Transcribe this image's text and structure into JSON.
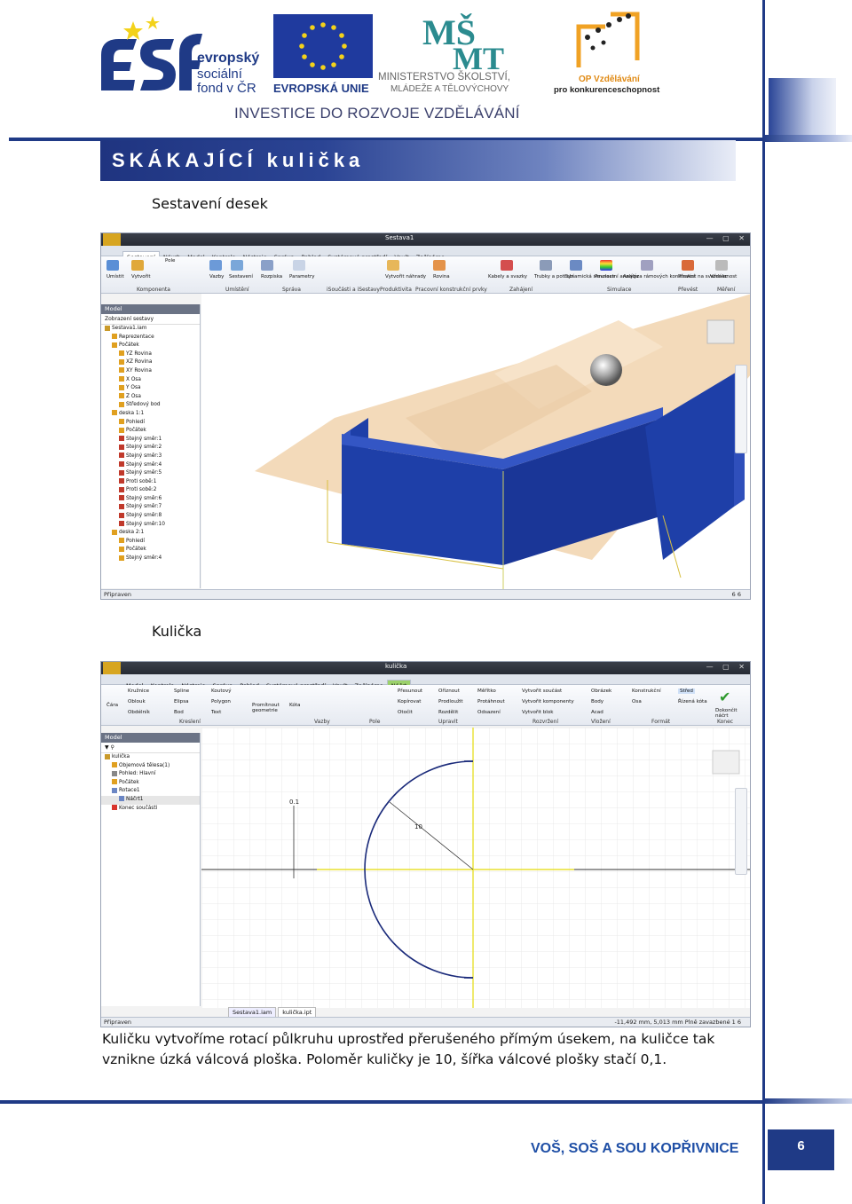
{
  "header": {
    "esf_text": [
      "evropský",
      "sociální",
      "fond v ČR"
    ],
    "eu_text": "EVROPSKÁ UNIE",
    "msmt_text": [
      "MINISTERSTVO ŠKOLSTVÍ,",
      "MLÁDEŽE A TĚLOVÝCHOVY"
    ],
    "opvk_text": [
      "OP Vzdělávání",
      "pro konkurenceschopnost"
    ],
    "investice": "INVESTICE DO ROZVOJE VZDĚLÁVÁNÍ",
    "title": "SKÁKAJÍCÍ kulička"
  },
  "section1": {
    "caption": "Sestavení desek",
    "window_title": "Sestava1",
    "tabs": [
      "Sestavení",
      "Návrh",
      "Model",
      "Kontrola",
      "Nástroje",
      "Správa",
      "Pohled",
      "Systémové prostředí",
      "Vault",
      "Začínáme"
    ],
    "ribbon_buttons": [
      "Umístit",
      "Vytvořit",
      "Pole",
      "Vazby",
      "Sestavení",
      "Rozpiska",
      "Parametry",
      "Vytvořit náhrady",
      "Rovina",
      "Kabely a svazky",
      "Trubky a potrubí",
      "Dynamická simulace",
      "Pevnostní analýza",
      "Analýza rámových konstrukcí",
      "Převést na svařenec",
      "Vzdálenost"
    ],
    "ribbon_groups": [
      "Komponenta",
      "Umístění",
      "Správa",
      "iSoučásti a iSestavy",
      "Produktivita",
      "Pracovní konstrukční prvky",
      "Zahájení",
      "Simulace",
      "Převést",
      "Měření"
    ],
    "browser_header": "Model",
    "browser_filter": "Zobrazení sestavy",
    "tree": [
      "Sestava1.iam",
      "Reprezentace",
      "Počátek",
      "YZ Rovina",
      "XZ Rovina",
      "XY Rovina",
      "X Osa",
      "Y Osa",
      "Z Osa",
      "Středový bod",
      "deska 1:1",
      "Pohledí",
      "Počátek",
      "Stejný směr:1",
      "Stejný směr:2",
      "Stejný směr:3",
      "Stejný směr:4",
      "Stejný směr:5",
      "Proti sobě:1",
      "Proti sobě:2",
      "Stejný směr:6",
      "Stejný směr:7",
      "Stejný směr:8",
      "Stejný směr:10",
      "deska 2:1",
      "Pohledí",
      "Počátek",
      "Stejný směr:4"
    ],
    "status_left": "Připraven",
    "status_right": "6    6"
  },
  "section2": {
    "caption": "Kulička",
    "window_title": "kulička",
    "tabs": [
      "Model",
      "Kontrola",
      "Nástroje",
      "Správa",
      "Pohled",
      "Systémové prostředí",
      "Vault",
      "Začínáme",
      "Náčrt"
    ],
    "ribbon_buttons": [
      "Čára",
      "Kružnice",
      "Oblouk",
      "Obdélník",
      "Spline",
      "Elipsa",
      "Bod",
      "Koutový",
      "Polygon",
      "Text",
      "Promítnout geometrie",
      "Kóta",
      "Přesunout",
      "Kopírovat",
      "Otočit",
      "Oříznout",
      "Prodloužit",
      "Rozdělit",
      "Měřítko",
      "Protáhnout",
      "Odsazení",
      "Vytvořit součást",
      "Vytvořit komponenty",
      "Vytvořit blok",
      "Obrázek",
      "Body",
      "Acad",
      "Konstrukční",
      "Osa",
      "Střed",
      "Řízená kóta",
      "Dokončit náčrt"
    ],
    "ribbon_groups": [
      "Kreslení",
      "Vazby",
      "Pole",
      "Upravit",
      "Rozvržení",
      "Vložení",
      "Formát",
      "Konec"
    ],
    "browser_header": "Model",
    "tree": [
      "kulička",
      "Objemová tělesa(1)",
      "Pohled: Hlavní",
      "Počátek",
      "Rotace1",
      "Náčrt1",
      "Konec součásti"
    ],
    "dim_small": "0.1",
    "dim_radius": "10",
    "file_tabs": [
      "Sestava1.iam",
      "kulička.ipt"
    ],
    "status_left": "Připraven",
    "status_right": "-11,492 mm, 5,013 mm    Plně zavazbené    1    6"
  },
  "body_text": "Kuličku vytvoříme rotací půlkruhu uprostřed přerušeného přímým úsekem, na kuličce tak vznikne úzká válcová ploška. Poloměr kuličky je 10, šířka válcové plošky stačí 0,1.",
  "footer": {
    "school": "VOŠ, SOŠ A SOU KOPŘIVNICE",
    "page": "6"
  },
  "colors": {
    "brand_blue": "#1f3a86",
    "board_blue": "#1e3fa8",
    "sketch_green": "#9bd16b"
  }
}
